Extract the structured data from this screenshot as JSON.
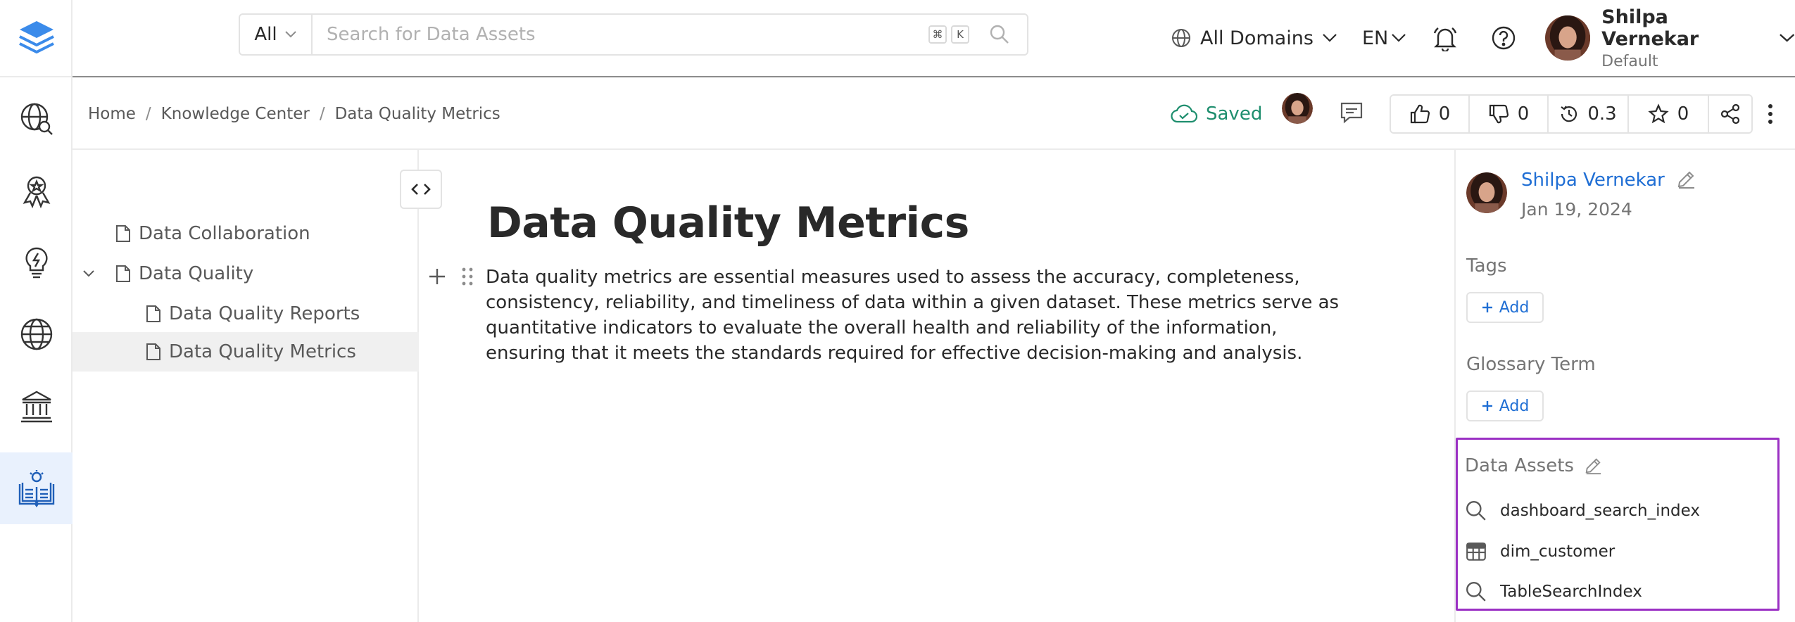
{
  "header": {
    "search": {
      "type_label": "All",
      "placeholder": "Search for Data Assets",
      "kbd_key": "K"
    },
    "domains_label": "All Domains",
    "language": "EN",
    "user": {
      "name": "Shilpa Vernekar",
      "role": "Default"
    }
  },
  "breadcrumb": [
    "Home",
    "Knowledge Center",
    "Data Quality Metrics"
  ],
  "status": {
    "saved_label": "Saved"
  },
  "actions": {
    "likes": "0",
    "dislikes": "0",
    "version": "0.3",
    "stars": "0"
  },
  "tree": {
    "items": [
      {
        "label": "Data Collaboration"
      },
      {
        "label": "Data Quality"
      },
      {
        "label": "Data Quality Reports"
      },
      {
        "label": "Data Quality Metrics"
      }
    ]
  },
  "page": {
    "title": "Data Quality Metrics",
    "paragraph": "Data quality metrics are essential measures used to assess the accuracy, completeness, consistency, reliability, and timeliness of data within a given dataset. These metrics serve as quantitative indicators to evaluate the overall health and reliability of the information, ensuring that it meets the standards required for effective decision-making and analysis."
  },
  "sidebar": {
    "owner": {
      "name": "Shilpa Vernekar",
      "date": "Jan 19, 2024"
    },
    "tags": {
      "label": "Tags",
      "add_label": "Add"
    },
    "glossary": {
      "label": "Glossary Term",
      "add_label": "Add"
    },
    "data_assets": {
      "label": "Data Assets",
      "items": [
        {
          "name": "dashboard_search_index",
          "icon": "search-icon"
        },
        {
          "name": "dim_customer",
          "icon": "table-icon"
        },
        {
          "name": "TableSearchIndex",
          "icon": "search-icon"
        }
      ]
    }
  },
  "colors": {
    "accent": "#1f6ed4",
    "saved": "#1e8e6e",
    "highlight": "#9b30c4",
    "active_nav": "#e9f1fd"
  }
}
